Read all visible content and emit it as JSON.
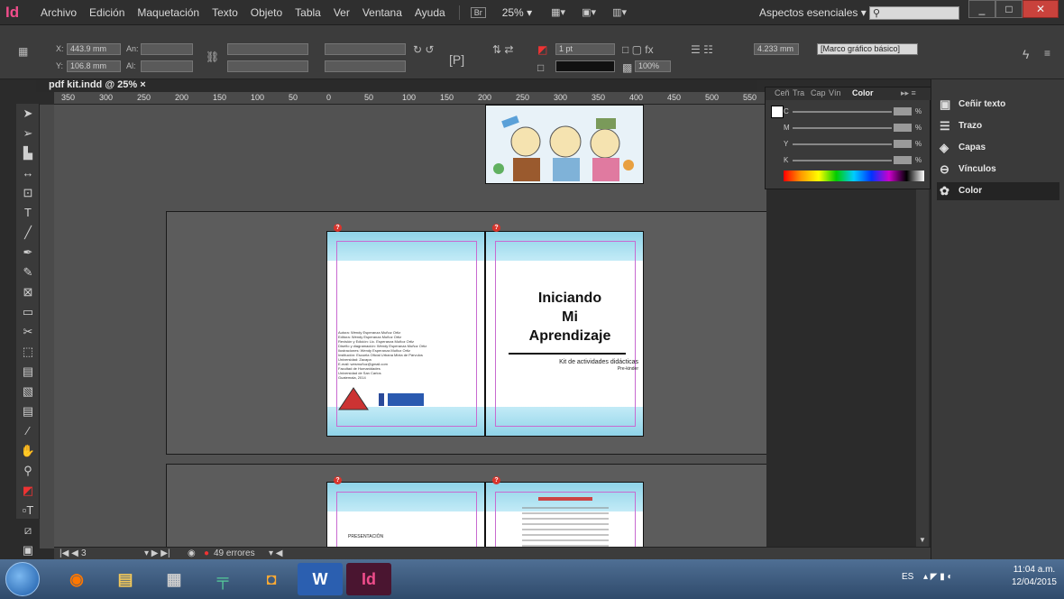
{
  "app": {
    "logo": "Id",
    "menu": [
      "Archivo",
      "Edición",
      "Maquetación",
      "Texto",
      "Objeto",
      "Tabla",
      "Ver",
      "Ventana",
      "Ayuda"
    ],
    "bridge_label": "Br",
    "zoom": "25%",
    "workspace": "Aspectos esenciales",
    "window_controls": {
      "minimize": "_",
      "maximize": "□",
      "close": "✕"
    }
  },
  "control_bar": {
    "x_label": "X:",
    "x_value": "443.9 mm",
    "y_label": "Y:",
    "y_value": "106.8 mm",
    "w_label": "An:",
    "h_label": "Al:",
    "stroke_weight": "1 pt",
    "opacity": "100%",
    "frame_value": "4.233 mm",
    "object_style": "[Marco gráfico básico]"
  },
  "document": {
    "tab": "pdf kit.indd @ 25%",
    "ruler_ticks": [
      "350",
      "300",
      "250",
      "200",
      "150",
      "100",
      "50",
      "0",
      "50",
      "100",
      "150",
      "200",
      "250",
      "300",
      "350",
      "400",
      "450",
      "500",
      "550"
    ]
  },
  "pages": {
    "cover_title": "Iniciando\nMi\nAprendizaje",
    "cover_subtitle": "Kit de actividades didácticas",
    "cover_subtitle2": "Pre-kinder",
    "credits": "Autora: Wendy Esperanza Muñoz Ortiz\nEditora: Wendy Esperanza Muñoz Ortiz\nRevisión y Edición: Lic. Esperanza Muñoz Ortiz\nDiseño y diagramación: Wendy Esperanza Muñoz Ortiz\nIlustraciones: Wendy Esperanza Muñoz Ortiz\nInstitución: Escuela Oficial Urbana Mixta de Párvulos\nUniversidad: Zacapa\nE-mail: wesmuñoz@gmail.com\nFacultad de Humanidades\nUniversidad de San Carlos\nGuatemala, 2014",
    "presentacion": "PRESENTACIÓN"
  },
  "status": {
    "page": "3",
    "errors": "49 errores"
  },
  "color_panel": {
    "tabs": [
      "Ceñ",
      "Tra",
      "Cap",
      "Vín",
      "Color"
    ],
    "channels": [
      "C",
      "M",
      "Y",
      "K"
    ],
    "percent": "%"
  },
  "dock": {
    "items": [
      "Ceñir texto",
      "Trazo",
      "Capas",
      "Vínculos",
      "Color"
    ]
  },
  "taskbar": {
    "language": "ES",
    "time": "11:04 a.m.",
    "date": "12/04/2015"
  },
  "colors": {
    "accent": "#f04d8b",
    "warning": "#d8342c",
    "margin_guide": "#c86ad0"
  }
}
